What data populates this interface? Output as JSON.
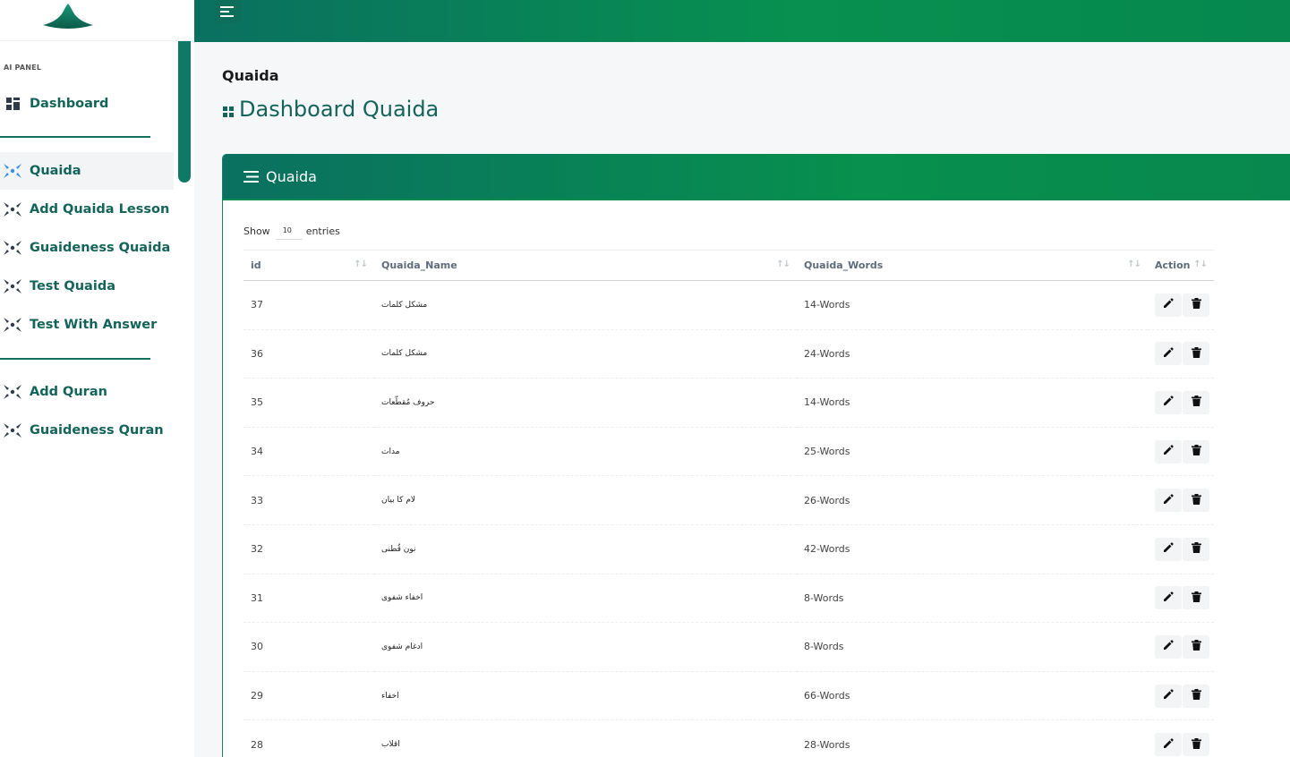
{
  "sidebar": {
    "panel_label": "AI PANEL",
    "items": [
      {
        "label": "Dashboard",
        "icon": "grid-icon"
      },
      {
        "label": "Quaida",
        "icon": "expand-icon",
        "active": true
      },
      {
        "label": "Add Quaida Lesson",
        "icon": "expand-icon"
      },
      {
        "label": "Guaideness Quaida",
        "icon": "expand-icon"
      },
      {
        "label": "Test Quaida",
        "icon": "expand-icon"
      },
      {
        "label": "Test With Answer",
        "icon": "expand-icon"
      },
      {
        "label": "Add Quran",
        "icon": "expand-icon"
      },
      {
        "label": "Guaideness Quran",
        "icon": "expand-icon"
      }
    ]
  },
  "header": {
    "breadcrumb": "Quaida",
    "title": "Dashboard Quaida"
  },
  "card": {
    "title": "Quaida",
    "show_label": "Show",
    "entries_value": "10",
    "entries_label": "entries"
  },
  "table": {
    "columns": [
      "id",
      "Quaida_Name",
      "Quaida_Words",
      "Action"
    ],
    "rows": [
      {
        "id": "37",
        "name": "مشکل کلمات",
        "words": "14-Words"
      },
      {
        "id": "36",
        "name": "مشکل کلمات",
        "words": "24-Words"
      },
      {
        "id": "35",
        "name": "حروف مُقطّعات",
        "words": "14-Words"
      },
      {
        "id": "34",
        "name": "مدات",
        "words": "25-Words"
      },
      {
        "id": "33",
        "name": "لام کا بیان",
        "words": "26-Words"
      },
      {
        "id": "32",
        "name": "نون قُطنی",
        "words": "42-Words"
      },
      {
        "id": "31",
        "name": "اخفاء شفوی",
        "words": "8-Words"
      },
      {
        "id": "30",
        "name": "ادغام شفوی",
        "words": "8-Words"
      },
      {
        "id": "29",
        "name": "اخفاء",
        "words": "66-Words"
      },
      {
        "id": "28",
        "name": "اقلاب",
        "words": "28-Words"
      }
    ]
  },
  "colors": {
    "primary": "#0a7060",
    "accent": "#07904e",
    "text_brand": "#14645a"
  }
}
